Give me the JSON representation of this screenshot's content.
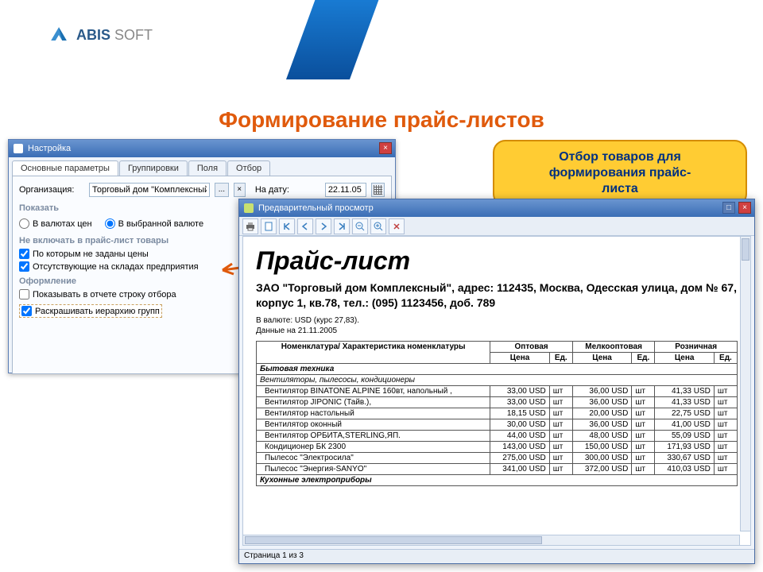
{
  "brand": {
    "name": "ABIS",
    "suffix": "SOFT"
  },
  "page_title": "Формирование прайс-листов",
  "callout": {
    "line1": "Отбор товаров для",
    "line2": "формирования прайс-",
    "line3": "листа"
  },
  "settings": {
    "win_title": "Настройка",
    "tabs": [
      "Основные параметры",
      "Группировки",
      "Поля",
      "Отбор"
    ],
    "org_label": "Организация:",
    "org_value": "Торговый дом \"Комплексный\"",
    "date_label": "На дату:",
    "date_value": "22.11.05",
    "groups": {
      "show": "Показать",
      "radio1": "В валютах цен",
      "radio2": "В выбранной валюте",
      "exclude": "Не включать в прайс-лист товары",
      "check1": "По которым не заданы цены",
      "check2": "Отсутствующие на складах предприятия",
      "design": "Оформление",
      "design_check1": "Показывать в отчете строку отбора",
      "design_check2": "Раскрашивать иерархию групп"
    }
  },
  "preview": {
    "win_title": "Предварительный просмотр",
    "doc_title": "Прайс-лист",
    "company": "ЗАО \"Торговый дом Комплексный\", адрес: 112435, Москва, Одесская улица, дом № 67, корпус 1, кв.78, тел.: (095) 1123456, доб. 789",
    "meta1": "В валюте: USD (курс 27,83).",
    "meta2": "Данные на 21.11.2005",
    "headers": {
      "name": "Номенклатура/ Характеристика номенклатуры",
      "p1": "Оптовая",
      "p2": "Мелкооптовая",
      "p3": "Розничная",
      "price": "Цена",
      "unit": "Ед."
    },
    "groups": [
      {
        "name": "Бытовая техника",
        "type": "group"
      },
      {
        "name": "Вентиляторы, пылесосы, кондиционеры",
        "type": "subgroup"
      }
    ],
    "rows": [
      {
        "name": "Вентилятор BINATONE ALPINE 160вт, напольный ,",
        "p1": "33,00 USD",
        "u1": "шт",
        "p2": "36,00 USD",
        "u2": "шт",
        "p3": "41,33 USD",
        "u3": "шт"
      },
      {
        "name": "Вентилятор JIPONIC (Тайв.),",
        "p1": "33,00 USD",
        "u1": "шт",
        "p2": "36,00 USD",
        "u2": "шт",
        "p3": "41,33 USD",
        "u3": "шт"
      },
      {
        "name": "Вентилятор настольный",
        "p1": "18,15 USD",
        "u1": "шт",
        "p2": "20,00 USD",
        "u2": "шт",
        "p3": "22,75 USD",
        "u3": "шт"
      },
      {
        "name": "Вентилятор оконный",
        "p1": "30,00 USD",
        "u1": "шт",
        "p2": "36,00 USD",
        "u2": "шт",
        "p3": "41,00 USD",
        "u3": "шт"
      },
      {
        "name": "Вентилятор ОРБИТА,STERLING,ЯП.",
        "p1": "44,00 USD",
        "u1": "шт",
        "p2": "48,00 USD",
        "u2": "шт",
        "p3": "55,09 USD",
        "u3": "шт"
      },
      {
        "name": "Кондиционер БК 2300",
        "p1": "143,00 USD",
        "u1": "шт",
        "p2": "150,00 USD",
        "u2": "шт",
        "p3": "171,93 USD",
        "u3": "шт"
      },
      {
        "name": "Пылесос \"Электросила\"",
        "p1": "275,00 USD",
        "u1": "шт",
        "p2": "300,00 USD",
        "u2": "шт",
        "p3": "330,67 USD",
        "u3": "шт"
      },
      {
        "name": "Пылесос \"Энергия-SANYO\"",
        "p1": "341,00 USD",
        "u1": "шт",
        "p2": "372,00 USD",
        "u2": "шт",
        "p3": "410,03 USD",
        "u3": "шт"
      }
    ],
    "group2": "Кухонные электроприборы",
    "status": "Страница 1 из 3"
  }
}
